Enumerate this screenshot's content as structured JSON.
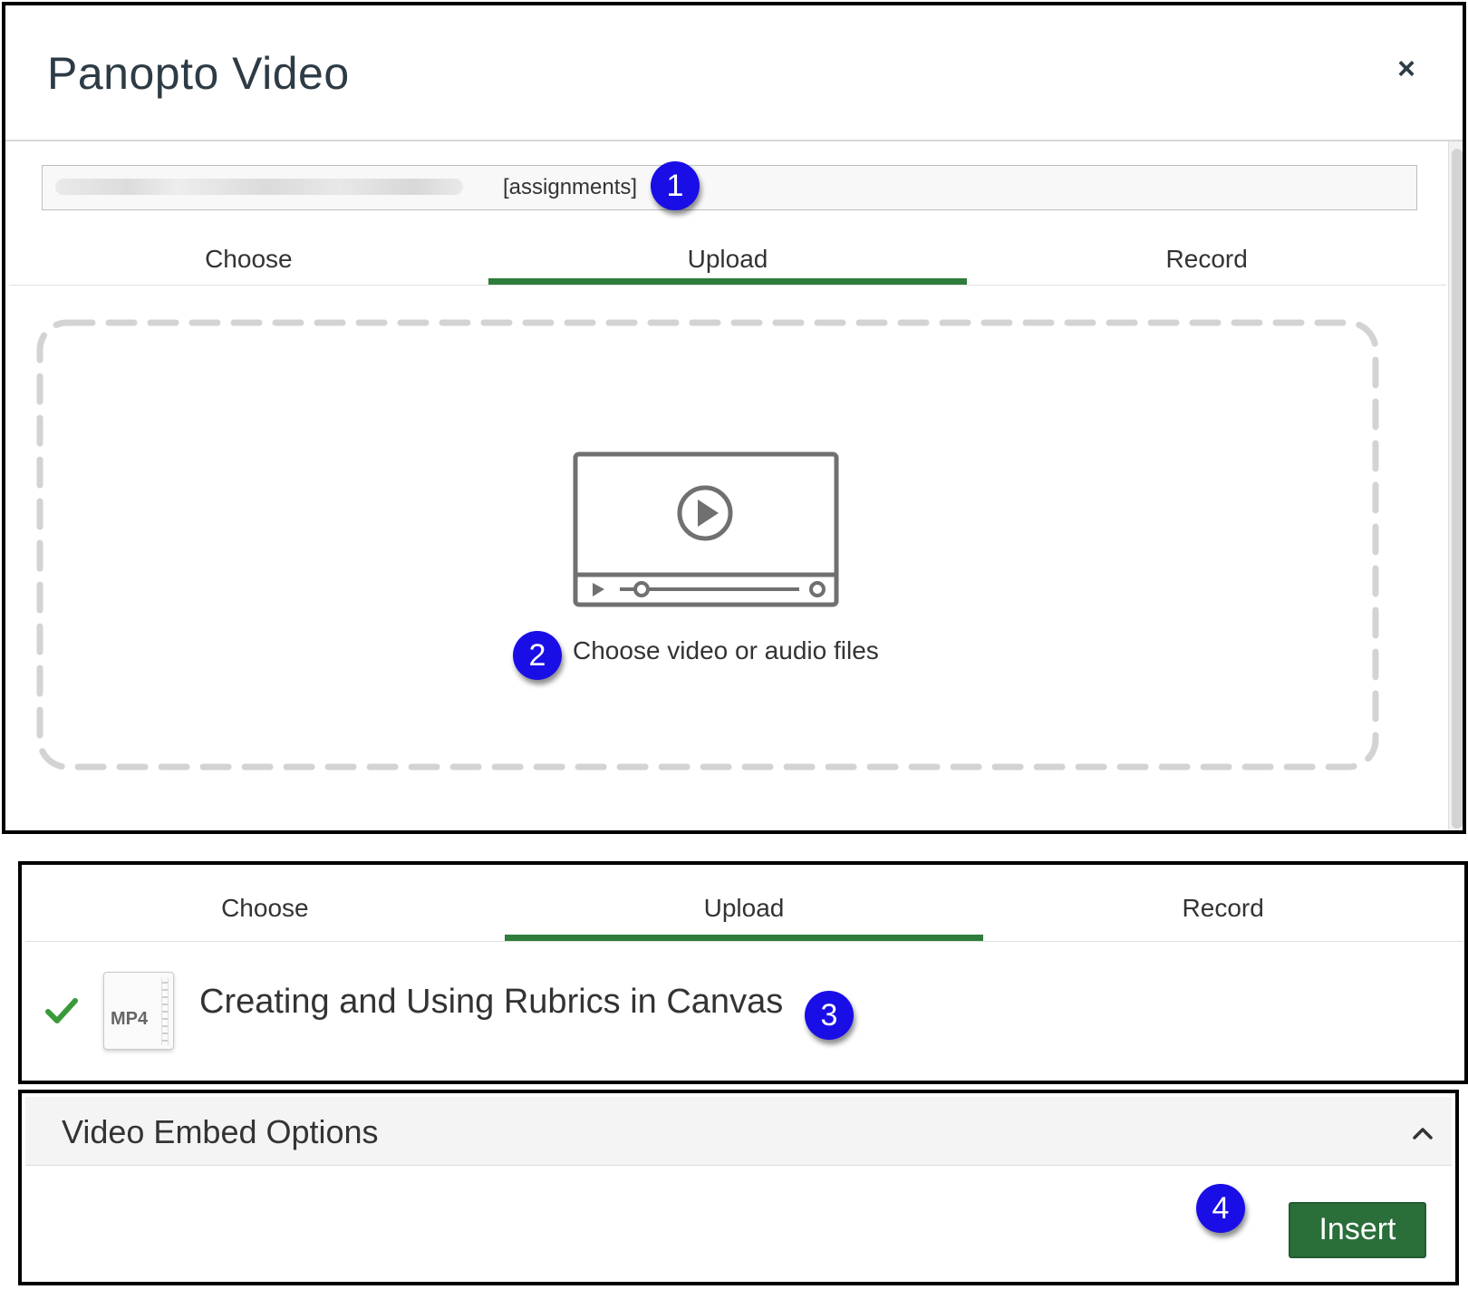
{
  "dialog": {
    "title": "Panopto Video",
    "close_label": "×",
    "folder_suffix": "[assignments]",
    "tabs": [
      {
        "label": "Choose",
        "active": false
      },
      {
        "label": "Upload",
        "active": true
      },
      {
        "label": "Record",
        "active": false
      }
    ],
    "dropzone_label": "Choose video or audio files"
  },
  "upload": {
    "tabs": [
      {
        "label": "Choose",
        "active": false
      },
      {
        "label": "Upload",
        "active": true
      },
      {
        "label": "Record",
        "active": false
      }
    ],
    "file": {
      "type_label": "MP4",
      "name": "Creating and Using Rubrics in Canvas",
      "status_icon": "checkmark-icon"
    }
  },
  "embed": {
    "title": "Video Embed Options",
    "insert_label": "Insert"
  },
  "callouts": [
    "1",
    "2",
    "3",
    "4"
  ],
  "colors": {
    "accent_green": "#2e7d3b",
    "button_green": "#2a6e3a",
    "callout_blue": "#1a0ee6",
    "check_green": "#3a9a3a"
  }
}
